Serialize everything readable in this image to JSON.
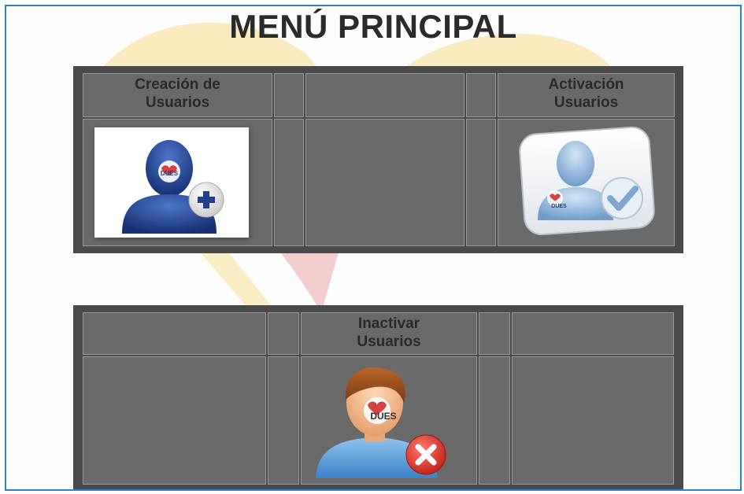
{
  "title": "MENÚ PRINCIPAL",
  "menu": {
    "create_users": {
      "line1": "Creación de",
      "line2": "Usuarios",
      "icon": "add-user-icon",
      "badge": "DUES"
    },
    "activate_users": {
      "line1": "Activación",
      "line2": "Usuarios",
      "icon": "activate-user-icon",
      "badge": "DUES"
    },
    "deactivate_users": {
      "line1": "Inactivar",
      "line2": "Usuarios",
      "icon": "deactivate-user-icon",
      "badge": "DUES"
    }
  },
  "colors": {
    "frame_border": "#2f7fd6",
    "table_border": "#4a4a4a",
    "watermark_yellow": "#f6dd8a",
    "watermark_red": "#e8a0a0"
  }
}
